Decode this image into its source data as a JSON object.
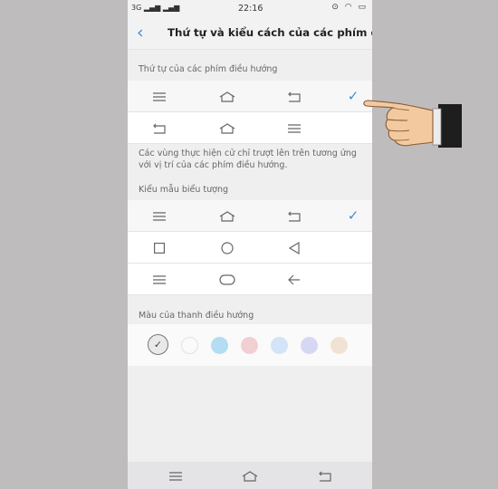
{
  "status": {
    "network": "3G",
    "time": "22:16"
  },
  "header": {
    "title": "Thứ tự và kiểu cách của các phím đi..."
  },
  "order_section": {
    "label": "Thứ tự của các phím điều hướng",
    "note": "Các vùng thực hiện cử chỉ trượt lên trên tương ứng với vị trí của các phím điều hướng.",
    "options": [
      {
        "icons": [
          "menu-icon",
          "home-icon",
          "back-icon"
        ],
        "selected": true
      },
      {
        "icons": [
          "back-icon",
          "home-icon",
          "menu-icon"
        ],
        "selected": false
      }
    ]
  },
  "style_section": {
    "label": "Kiểu mẫu biểu tượng",
    "options": [
      {
        "icons": [
          "menu-icon",
          "home-icon",
          "back-icon"
        ],
        "selected": true
      },
      {
        "icons": [
          "square-icon",
          "circle-icon",
          "triangle-back-icon"
        ],
        "selected": false
      },
      {
        "icons": [
          "menu-icon",
          "pill-icon",
          "arrow-left-icon"
        ],
        "selected": false
      }
    ]
  },
  "color_section": {
    "label": "Màu của thanh điều hướng",
    "colors": [
      "#e9e9e9",
      "#fafafa",
      "#b2ddf2",
      "#f1cfd3",
      "#d3e4f6",
      "#d6d8f3",
      "#f1e3d3"
    ],
    "selected_index": 0
  },
  "accent_color": "#3d8fd4"
}
